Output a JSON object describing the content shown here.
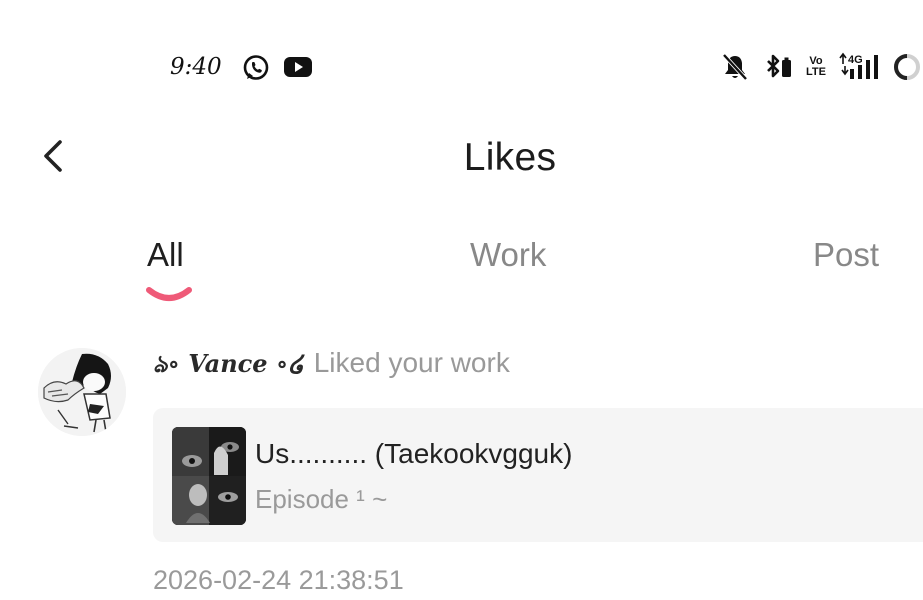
{
  "status_bar": {
    "time": "9:40",
    "icons": [
      "whatsapp-icon",
      "youtube-icon",
      "bell-off-icon",
      "bluetooth-icon",
      "volte-icon",
      "signal-4g-icon",
      "battery-icon"
    ],
    "volte_top": "Vo",
    "volte_bottom": "LTE",
    "network": "4G"
  },
  "header": {
    "back_icon": "chevron-left-icon",
    "title": "Likes"
  },
  "tabs": [
    {
      "label": "All",
      "active": true
    },
    {
      "label": "Work",
      "active": false
    },
    {
      "label": "Post",
      "active": false
    }
  ],
  "colors": {
    "accent": "#ef5a78",
    "card_bg": "#f5f5f5",
    "muted_text": "#999999"
  },
  "notifications": [
    {
      "username": "ঌ∘ Vance ∘໒",
      "action": "Liked your work",
      "work": {
        "title": "Us.......... (Taekookvgguk)",
        "episode": "Episode ¹ ~"
      },
      "timestamp": "2026-02-24 21:38:51"
    }
  ]
}
